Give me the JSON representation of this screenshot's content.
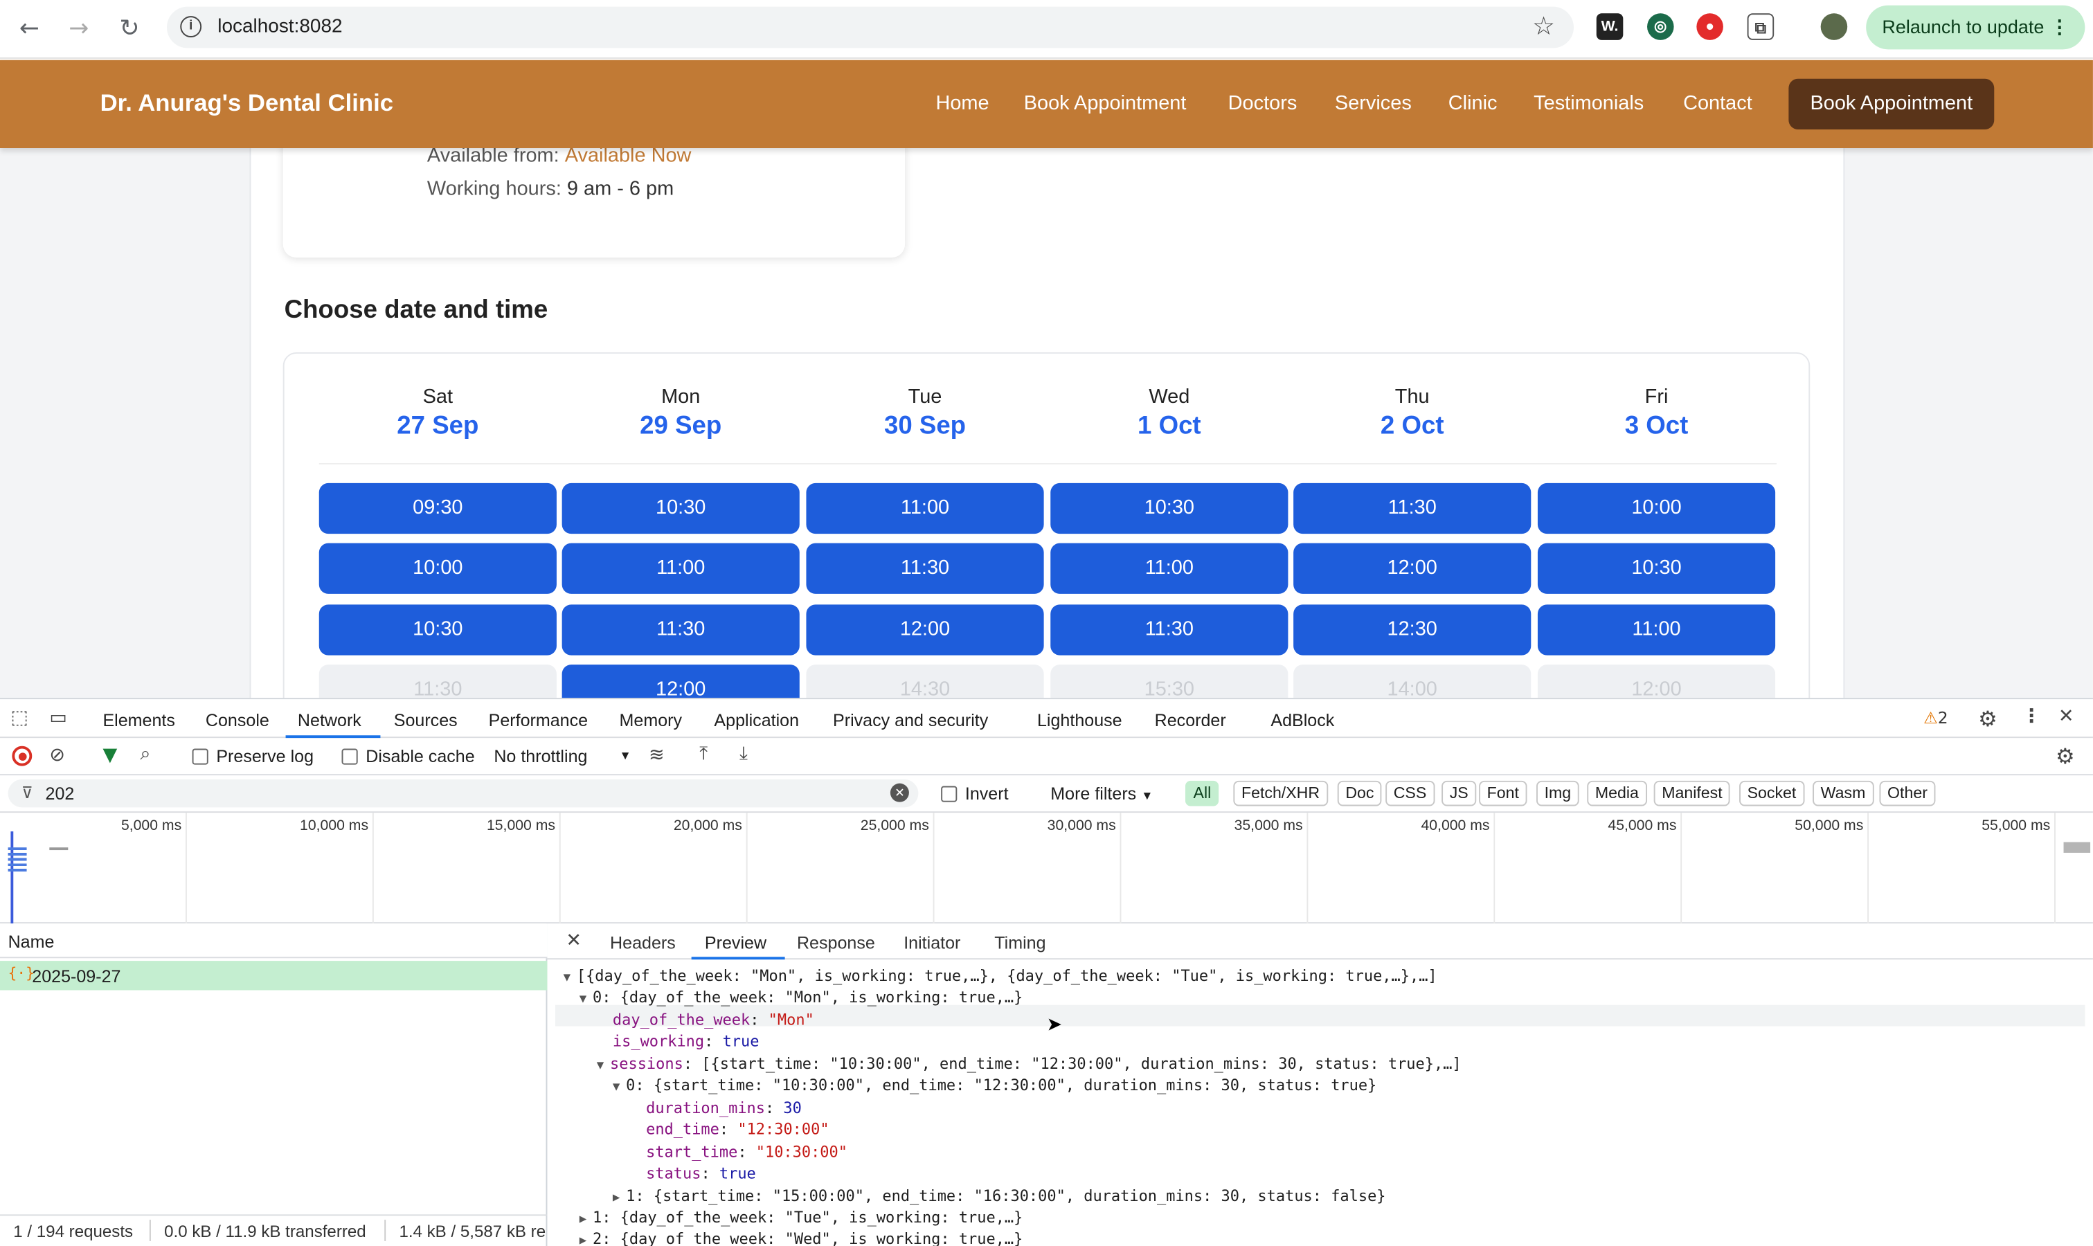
{
  "browser": {
    "url": "localhost:8082",
    "relaunch_label": "Relaunch to update"
  },
  "site": {
    "brand": "Dr. Anurag's Dental Clinic",
    "nav": [
      "Home",
      "Book Appointment",
      "Doctors",
      "Services",
      "Clinic",
      "Testimonials",
      "Contact"
    ],
    "cta": "Book Appointment",
    "doctor_card": {
      "available_label": "Available from:",
      "available_value": "Available Now",
      "hours_label": "Working hours:",
      "hours_value": "9 am - 6 pm"
    },
    "section_title": "Choose date and time",
    "days": [
      {
        "name": "Sat",
        "date": "27 Sep",
        "slots": [
          {
            "t": "09:30",
            "on": true
          },
          {
            "t": "10:00",
            "on": true
          },
          {
            "t": "10:30",
            "on": true
          },
          {
            "t": "11:30",
            "on": false
          }
        ]
      },
      {
        "name": "Mon",
        "date": "29 Sep",
        "slots": [
          {
            "t": "10:30",
            "on": true
          },
          {
            "t": "11:00",
            "on": true
          },
          {
            "t": "11:30",
            "on": true
          },
          {
            "t": "12:00",
            "on": true
          }
        ]
      },
      {
        "name": "Tue",
        "date": "30 Sep",
        "slots": [
          {
            "t": "11:00",
            "on": true
          },
          {
            "t": "11:30",
            "on": true
          },
          {
            "t": "12:00",
            "on": true
          },
          {
            "t": "14:30",
            "on": false
          }
        ]
      },
      {
        "name": "Wed",
        "date": "1 Oct",
        "slots": [
          {
            "t": "10:30",
            "on": true
          },
          {
            "t": "11:00",
            "on": true
          },
          {
            "t": "11:30",
            "on": true
          },
          {
            "t": "15:30",
            "on": false
          }
        ]
      },
      {
        "name": "Thu",
        "date": "2 Oct",
        "slots": [
          {
            "t": "11:30",
            "on": true
          },
          {
            "t": "12:00",
            "on": true
          },
          {
            "t": "12:30",
            "on": true
          },
          {
            "t": "14:00",
            "on": false
          }
        ]
      },
      {
        "name": "Fri",
        "date": "3 Oct",
        "slots": [
          {
            "t": "10:00",
            "on": true
          },
          {
            "t": "10:30",
            "on": true
          },
          {
            "t": "11:00",
            "on": true
          },
          {
            "t": "12:00",
            "on": false
          }
        ]
      }
    ],
    "colors": {
      "header": "#c17a35",
      "cta": "#5a3419",
      "slot": "#1e5ddb",
      "date": "#2563eb"
    }
  },
  "devtools": {
    "tabs": [
      "Elements",
      "Console",
      "Network",
      "Sources",
      "Performance",
      "Memory",
      "Application",
      "Privacy and security",
      "Lighthouse",
      "Recorder",
      "AdBlock"
    ],
    "active_tab": "Network",
    "warning_count": "2",
    "toolbar": {
      "preserve_log": "Preserve log",
      "disable_cache": "Disable cache",
      "throttling": "No throttling"
    },
    "filter": {
      "value": "202",
      "invert": "Invert",
      "more_filters": "More filters",
      "chips": [
        "All",
        "Fetch/XHR",
        "Doc",
        "CSS",
        "JS",
        "Font",
        "Img",
        "Media",
        "Manifest",
        "Socket",
        "Wasm",
        "Other"
      ],
      "active_chip": "All"
    },
    "timeline_ticks": [
      "5,000 ms",
      "10,000 ms",
      "15,000 ms",
      "20,000 ms",
      "25,000 ms",
      "30,000 ms",
      "35,000 ms",
      "40,000 ms",
      "45,000 ms",
      "50,000 ms",
      "55,000 ms"
    ],
    "name_header": "Name",
    "request_name": "2025-09-27",
    "status": {
      "requests": "1 / 194 requests",
      "transferred": "0.0 kB / 11.9 kB transferred",
      "resources": "1.4 kB / 5,587 kB re"
    },
    "detail_tabs": [
      "Headers",
      "Preview",
      "Response",
      "Initiator",
      "Timing"
    ],
    "active_detail_tab": "Preview",
    "preview": {
      "root": "[{day_of_the_week: \"Mon\", is_working: true,…}, {day_of_the_week: \"Tue\", is_working: true,…},…]",
      "item0": "0: {day_of_the_week: \"Mon\", is_working: true,…}",
      "dow_key": "day_of_the_week",
      "dow_val": "\"Mon\"",
      "working_key": "is_working",
      "working_val": "true",
      "sessions_key": "sessions",
      "sessions_val": "[{start_time: \"10:30:00\", end_time: \"12:30:00\", duration_mins: 30, status: true},…]",
      "s0": "0: {start_time: \"10:30:00\", end_time: \"12:30:00\", duration_mins: 30, status: true}",
      "dur_key": "duration_mins",
      "dur_val": "30",
      "end_key": "end_time",
      "end_val": "\"12:30:00\"",
      "start_key": "start_time",
      "start_val": "\"10:30:00\"",
      "status_key": "status",
      "status_val": "true",
      "s1": "1: {start_time: \"15:00:00\", end_time: \"16:30:00\", duration_mins: 30, status: false}",
      "item1": "1: {day_of_the_week: \"Tue\", is_working: true,…}",
      "item2": "2: {day_of_the_week: \"Wed\", is_working: true,…}"
    }
  }
}
